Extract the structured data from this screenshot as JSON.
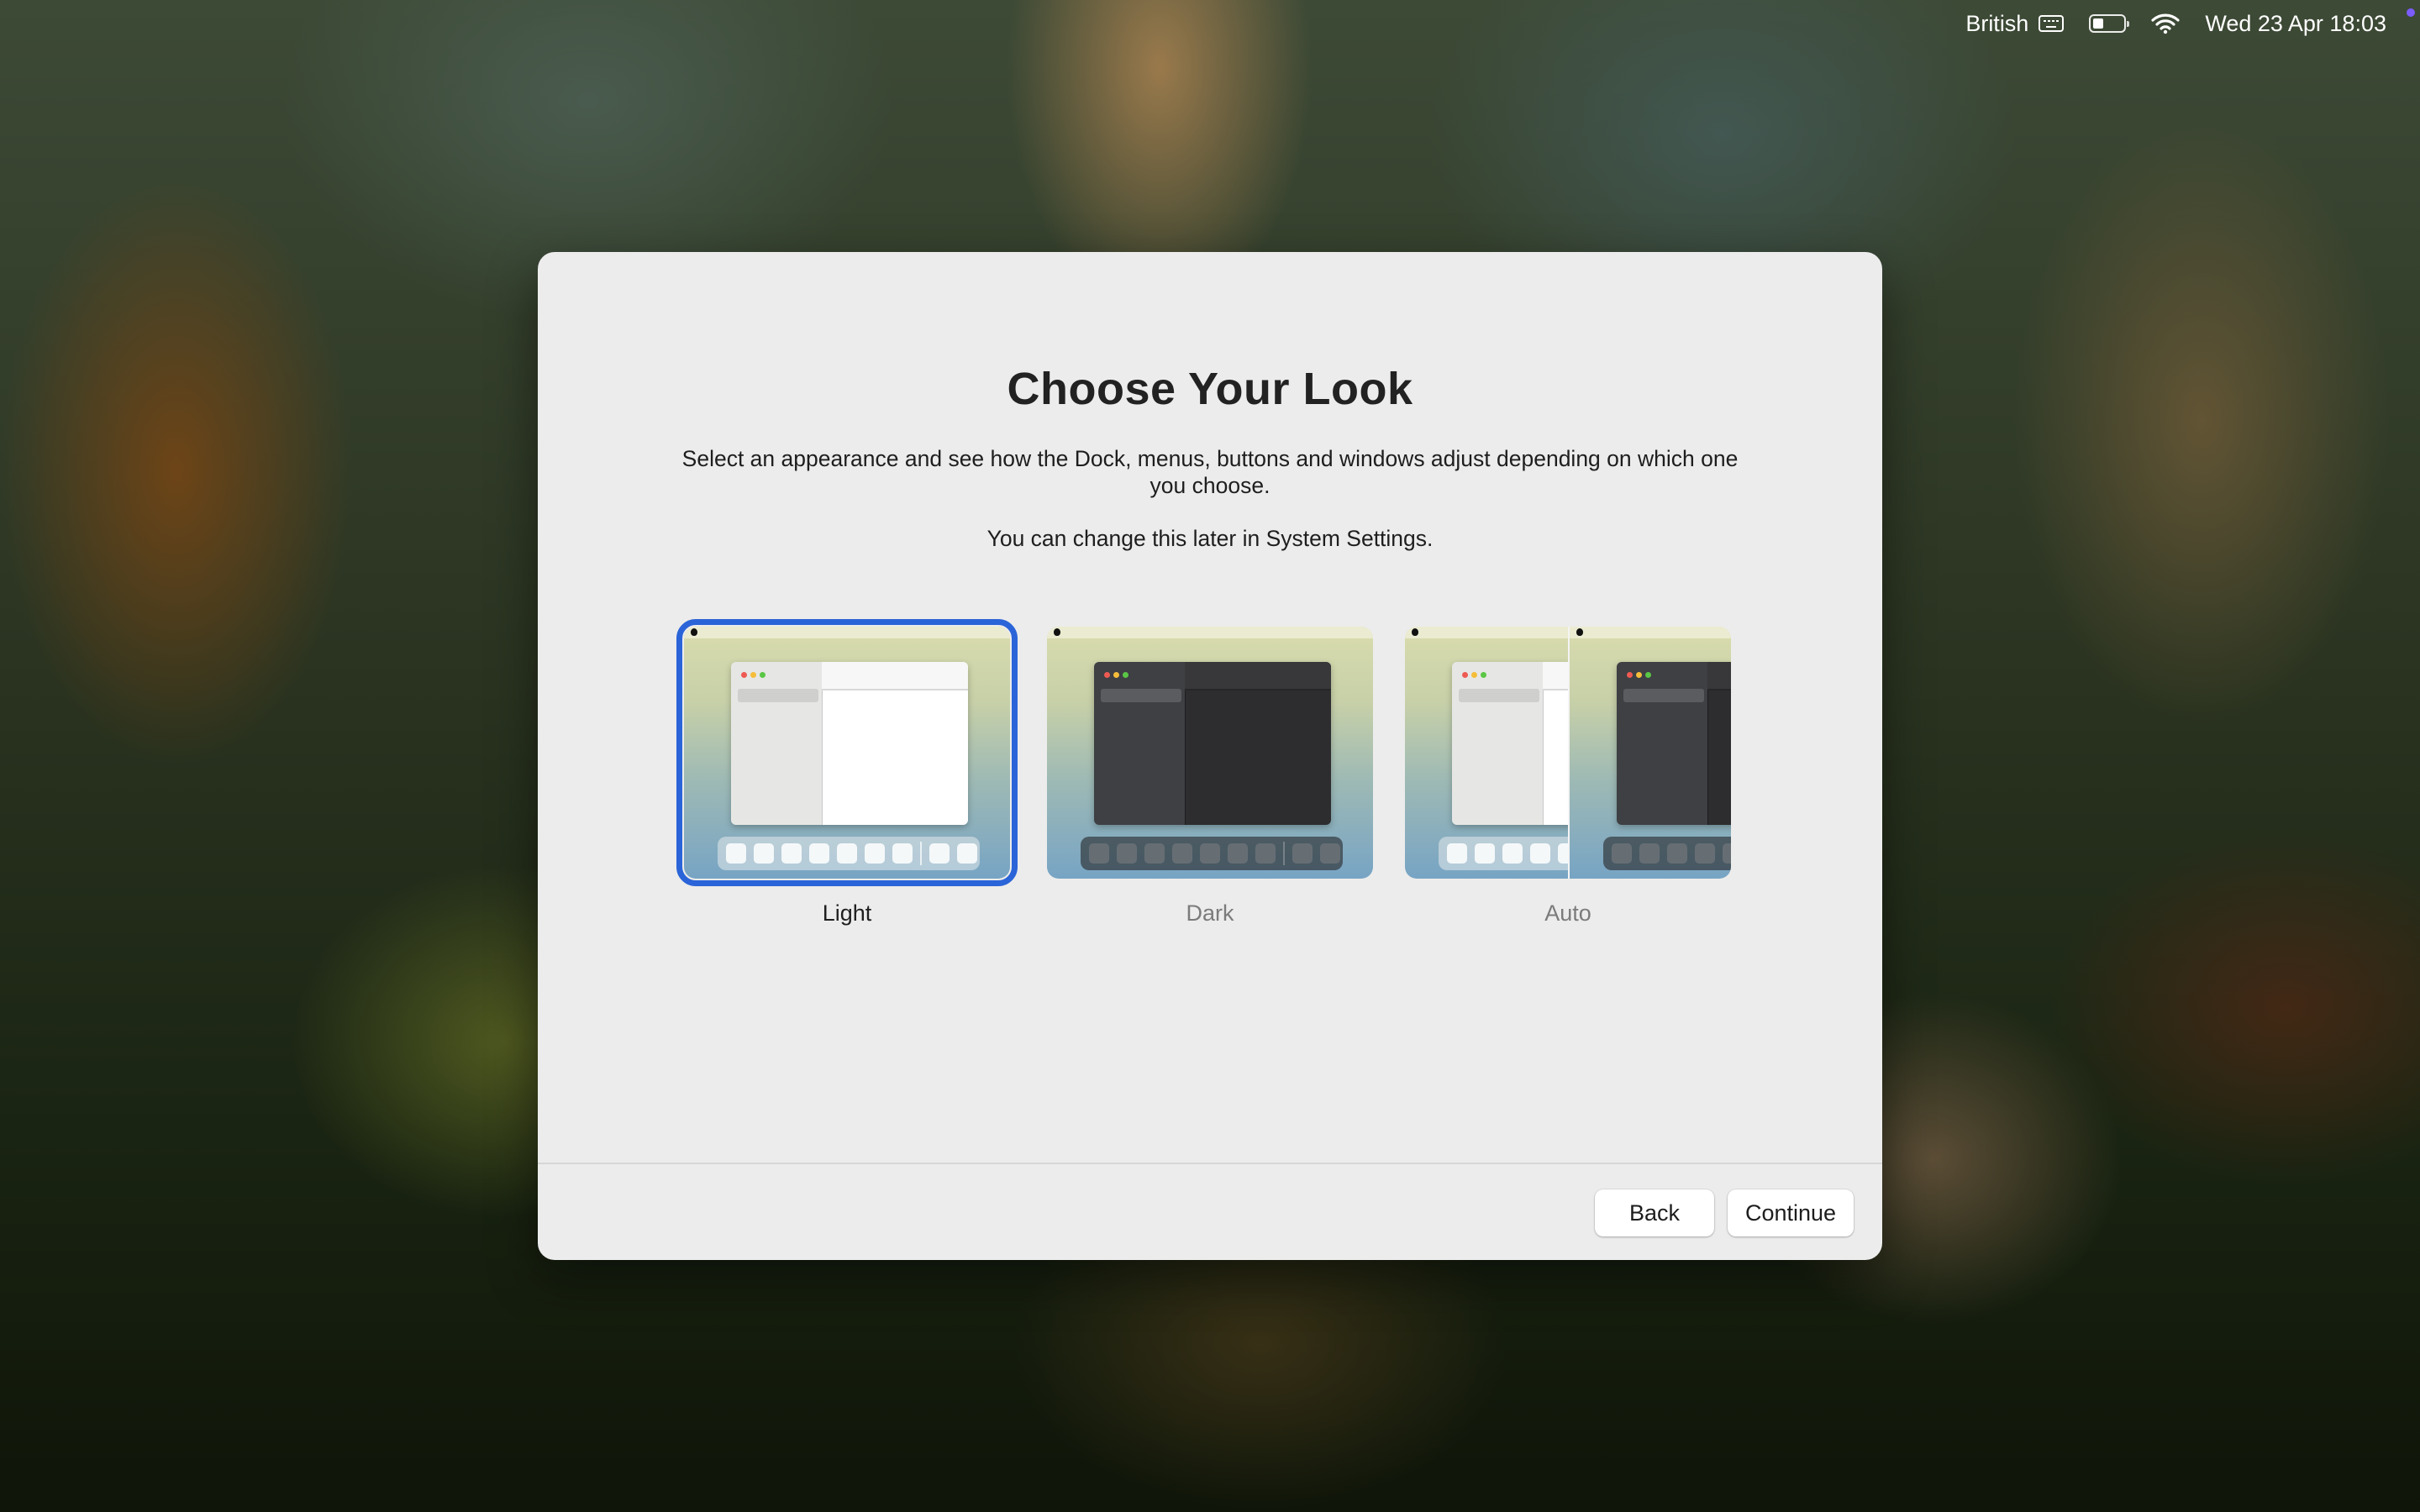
{
  "menubar": {
    "input_source": "British",
    "datetime": "Wed 23 Apr 18:03",
    "icons": [
      "keyboard-icon",
      "battery-icon",
      "wifi-icon"
    ]
  },
  "dialog": {
    "title": "Choose Your Look",
    "description": "Select an appearance and see how the Dock, menus, buttons and windows adjust depending on which one you choose.",
    "note": "You can change this later in System Settings.",
    "options": [
      {
        "label": "Light",
        "selected": true
      },
      {
        "label": "Dark",
        "selected": false
      },
      {
        "label": "Auto",
        "selected": false
      }
    ],
    "buttons": {
      "back": "Back",
      "continue": "Continue"
    }
  },
  "colors": {
    "selection_accent": "#2a64d8",
    "dialog_background": "#ececec"
  }
}
